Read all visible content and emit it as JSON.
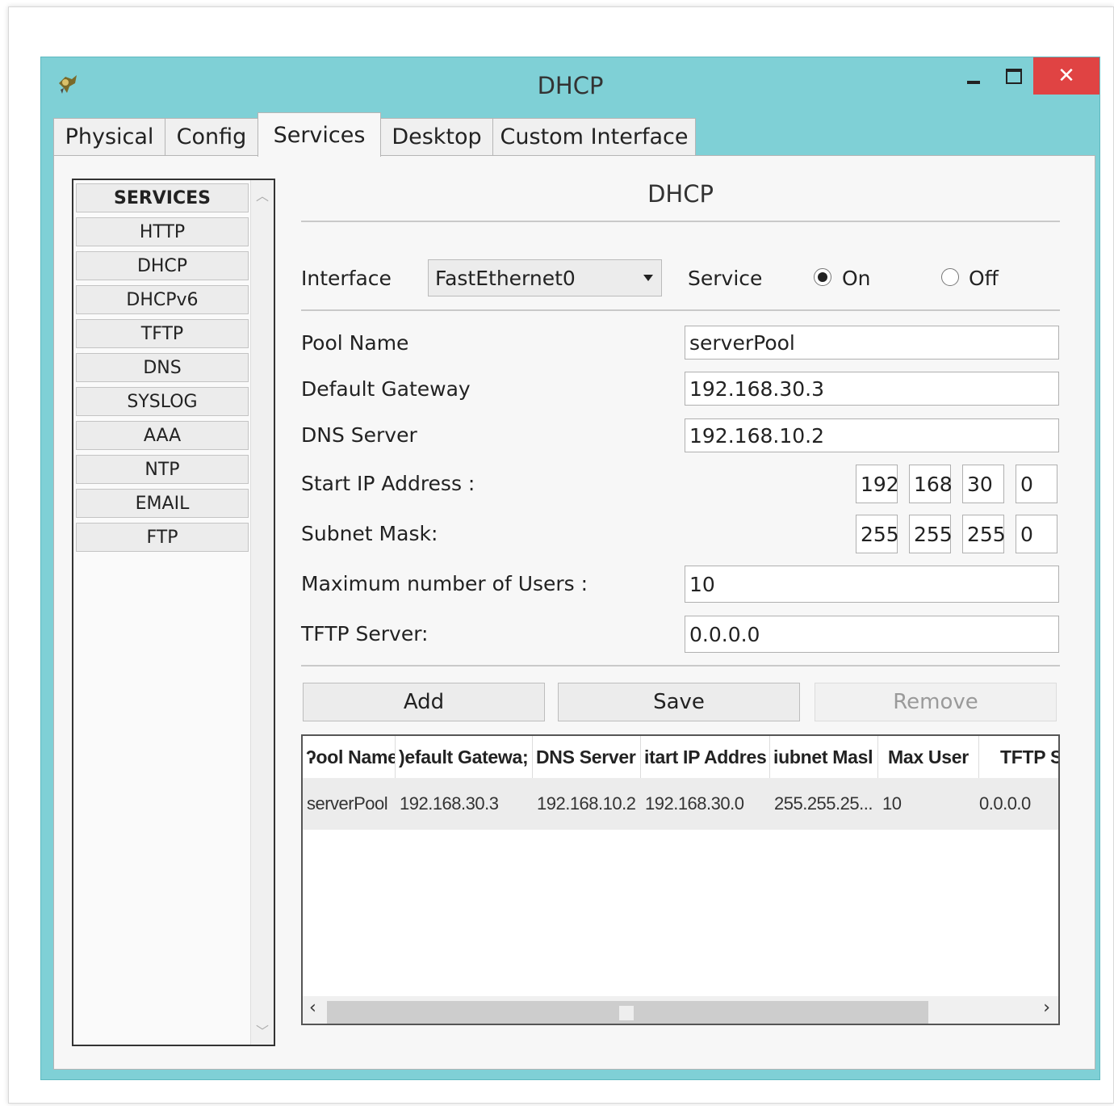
{
  "window": {
    "title": "DHCP",
    "controls": {
      "close": "✕"
    }
  },
  "tabs": [
    {
      "label": "Physical",
      "active": false
    },
    {
      "label": "Config",
      "active": false
    },
    {
      "label": "Services",
      "active": true
    },
    {
      "label": "Desktop",
      "active": false
    },
    {
      "label": "Custom Interface",
      "active": false
    }
  ],
  "sidebar": {
    "header": "SERVICES",
    "items": [
      "HTTP",
      "DHCP",
      "DHCPv6",
      "TFTP",
      "DNS",
      "SYSLOG",
      "AAA",
      "NTP",
      "EMAIL",
      "FTP"
    ]
  },
  "dhcp": {
    "section_title": "DHCP",
    "interface_label": "Interface",
    "interface_value": "FastEthernet0",
    "service_label": "Service",
    "service_on_label": "On",
    "service_off_label": "Off",
    "service_state": "On",
    "pool_name_label": "Pool Name",
    "pool_name_value": "serverPool",
    "default_gateway_label": "Default Gateway",
    "default_gateway_value": "192.168.30.3",
    "dns_server_label": "DNS Server",
    "dns_server_value": "192.168.10.2",
    "start_ip_label": "Start IP Address :",
    "start_ip_octets": [
      "192",
      "168",
      "30",
      "0"
    ],
    "subnet_mask_label": "Subnet Mask:",
    "subnet_mask_octets": [
      "255",
      "255",
      "255",
      "0"
    ],
    "max_users_label": "Maximum number of Users :",
    "max_users_value": "10",
    "tftp_server_label": "TFTP Server:",
    "tftp_server_value": "0.0.0.0",
    "buttons": {
      "add": "Add",
      "save": "Save",
      "remove": "Remove"
    }
  },
  "pool_table": {
    "columns": [
      "ʔool Name",
      ")efault Gatewa;",
      "DNS Server",
      "itart IP Addres",
      "iubnet Masl",
      "Max User",
      "TFTP S"
    ],
    "rows": [
      [
        "serverPool",
        "192.168.30.3",
        "192.168.10.2",
        "192.168.30.0",
        "255.255.25...",
        "10",
        "0.0.0.0"
      ]
    ]
  },
  "colors": {
    "titlebar": "#7fd0d6",
    "close_button": "#e04343",
    "panel_bg": "#f7f7f7"
  }
}
